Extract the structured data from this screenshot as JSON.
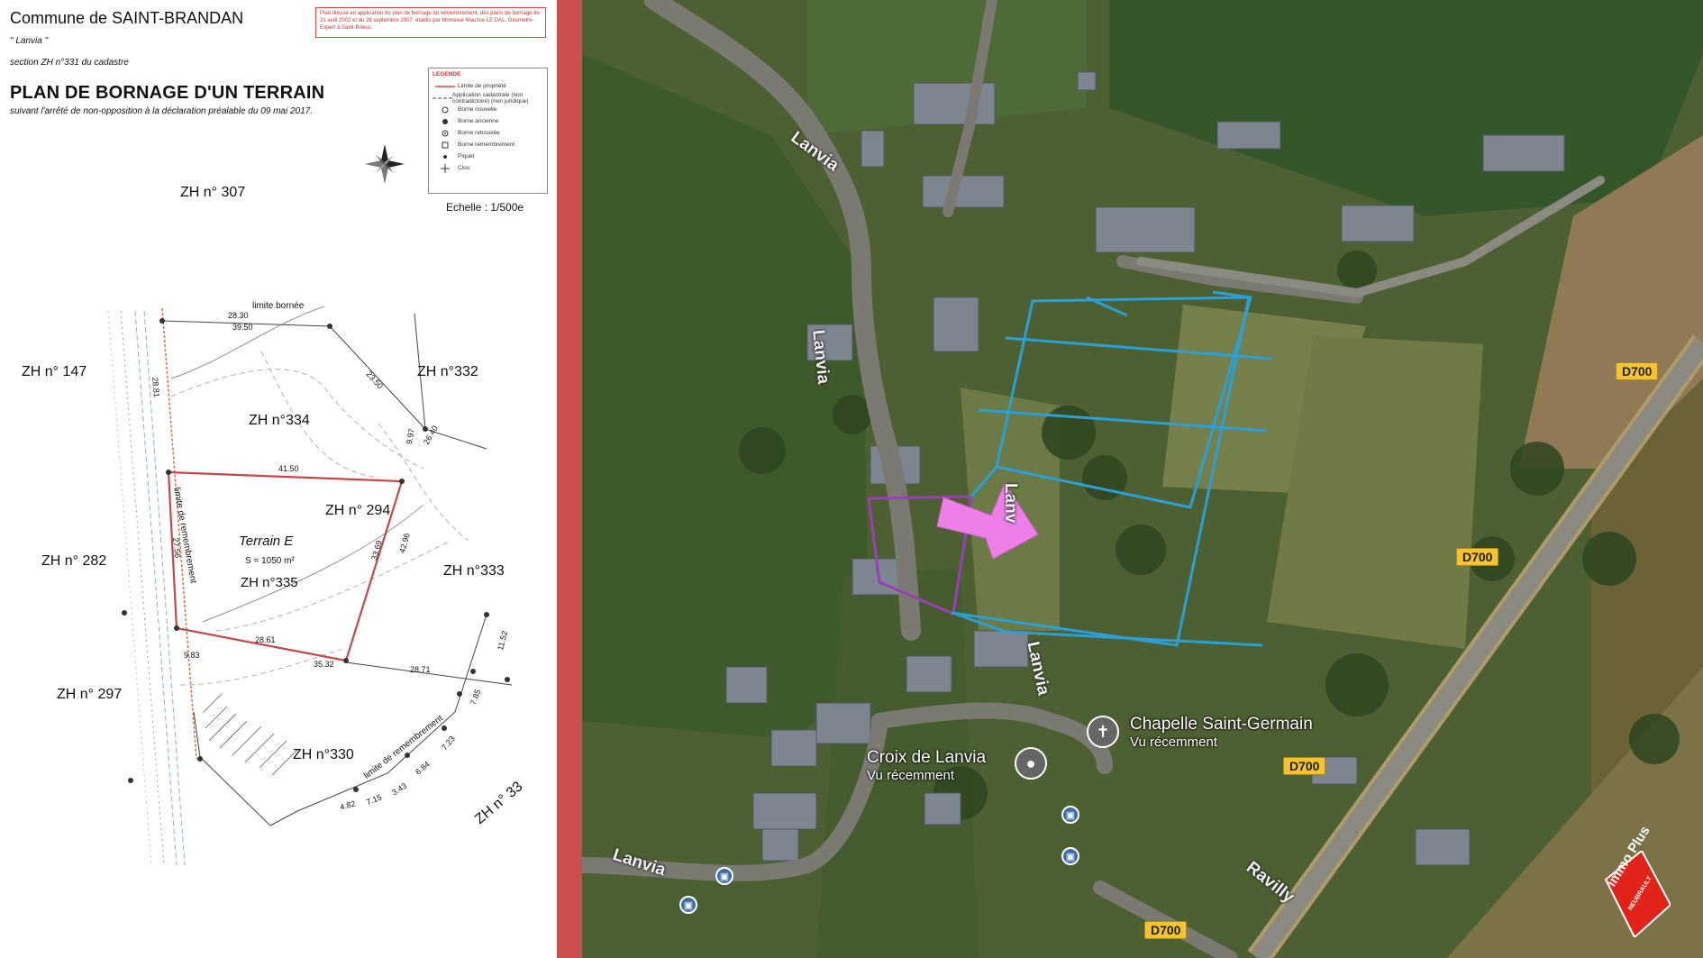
{
  "plan": {
    "commune": "Commune de SAINT-BRANDAN",
    "lieu": "\" Lanvia \"",
    "section": "section ZH n°331 du cadastre",
    "title": "PLAN DE BORNAGE D'UN TERRAIN",
    "arrete": "suivant l'arrêté de non-opposition à la déclaration préalable du 09 mai 2017.",
    "note": "Plan dressé en application du plan de bornage du remembrement, des plans de bornage du 21 avril 2002 et du 28 septembre 2007, établis par Monsieur Maurice LE DAL, Géomètre-Expert à Saint-Brieuc.",
    "echelle": "Echelle : 1/500e",
    "legend": {
      "title": "LEGENDE",
      "items": [
        "Limite de propriété",
        "Application cadastrale (non contradictoire) (non juridique)",
        "Borne nouvelle",
        "Borne ancienne",
        "Borne retrouvée",
        "Borne remembrement",
        "Piquet",
        "Clou"
      ]
    },
    "parcels": {
      "zh307": "ZH n° 307",
      "zh147": "ZH n° 147",
      "zh332": "ZH n°332",
      "zh334": "ZH n°334",
      "zh294": "ZH n° 294",
      "zh282": "ZH n° 282",
      "zh333": "ZH n°333",
      "zh297": "ZH n° 297",
      "zh330": "ZH n°330",
      "zh33": "ZH n° 33",
      "terrain": "Terrain E",
      "surface": "S = 1050 m²",
      "zh335": "ZH n°335"
    },
    "annotations": {
      "limite_bornee": "limite bornée",
      "limite_remb_1": "limite de remembrement",
      "limite_remb_2": "limite de remembrement"
    },
    "dimensions": [
      "28.30",
      "39.50",
      "23.50",
      "9.97",
      "41.50",
      "26.40",
      "28.61",
      "35.32",
      "28.71",
      "27.56",
      "9.83",
      "33.69",
      "42.96",
      "7.85",
      "11.52",
      "7.23",
      "6.84",
      "3.43",
      "7.15",
      "4.82",
      "28.81"
    ]
  },
  "map": {
    "roads": {
      "lanvia_1": "Lanvia",
      "lanvia_2": "Lanvia",
      "lanvia_3": "Lanv",
      "lanvia_4": "Lanvia",
      "lanvia_5": "Lanvia",
      "ravilly": "Ravilly"
    },
    "shields": [
      "D700",
      "D700",
      "D700",
      "D700"
    ],
    "pois": {
      "chapelle": "Chapelle Saint-Germain",
      "chapelle_sub": "Vu récemment",
      "croix": "Croix de Lanvia",
      "croix_sub": "Vu récemment"
    },
    "stamp": {
      "brand": "immo Plus",
      "agency": "NEUBRAULT"
    },
    "colors": {
      "parcel_outline": "#9b3fb5",
      "lots_outline": "#2aa0d6",
      "arrow": "#ee7fe8"
    }
  }
}
